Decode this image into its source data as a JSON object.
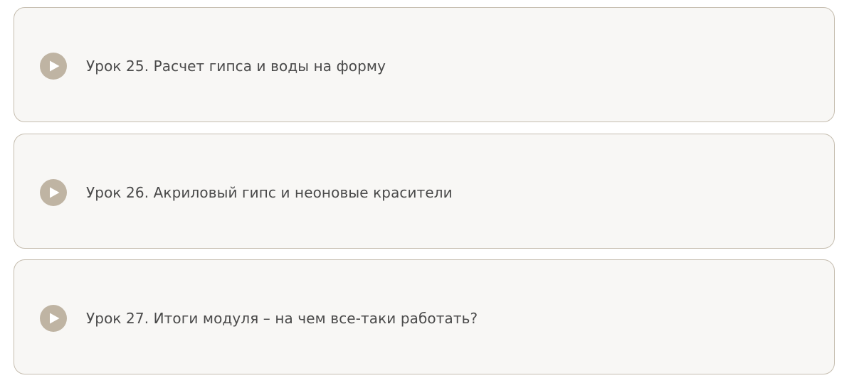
{
  "colors": {
    "card_background": "#f8f7f5",
    "card_border": "#c5bdaf",
    "icon_background": "#bfb4a3",
    "text": "#4a4a4a"
  },
  "lessons": [
    {
      "title": "Урок 25. Расчет гипса и воды на форму",
      "icon": "play-icon"
    },
    {
      "title": "Урок 26. Акриловый гипс и неоновые красители",
      "icon": "play-icon"
    },
    {
      "title": "Урок 27. Итоги модуля – на чем все-таки работать?",
      "icon": "play-icon"
    }
  ]
}
